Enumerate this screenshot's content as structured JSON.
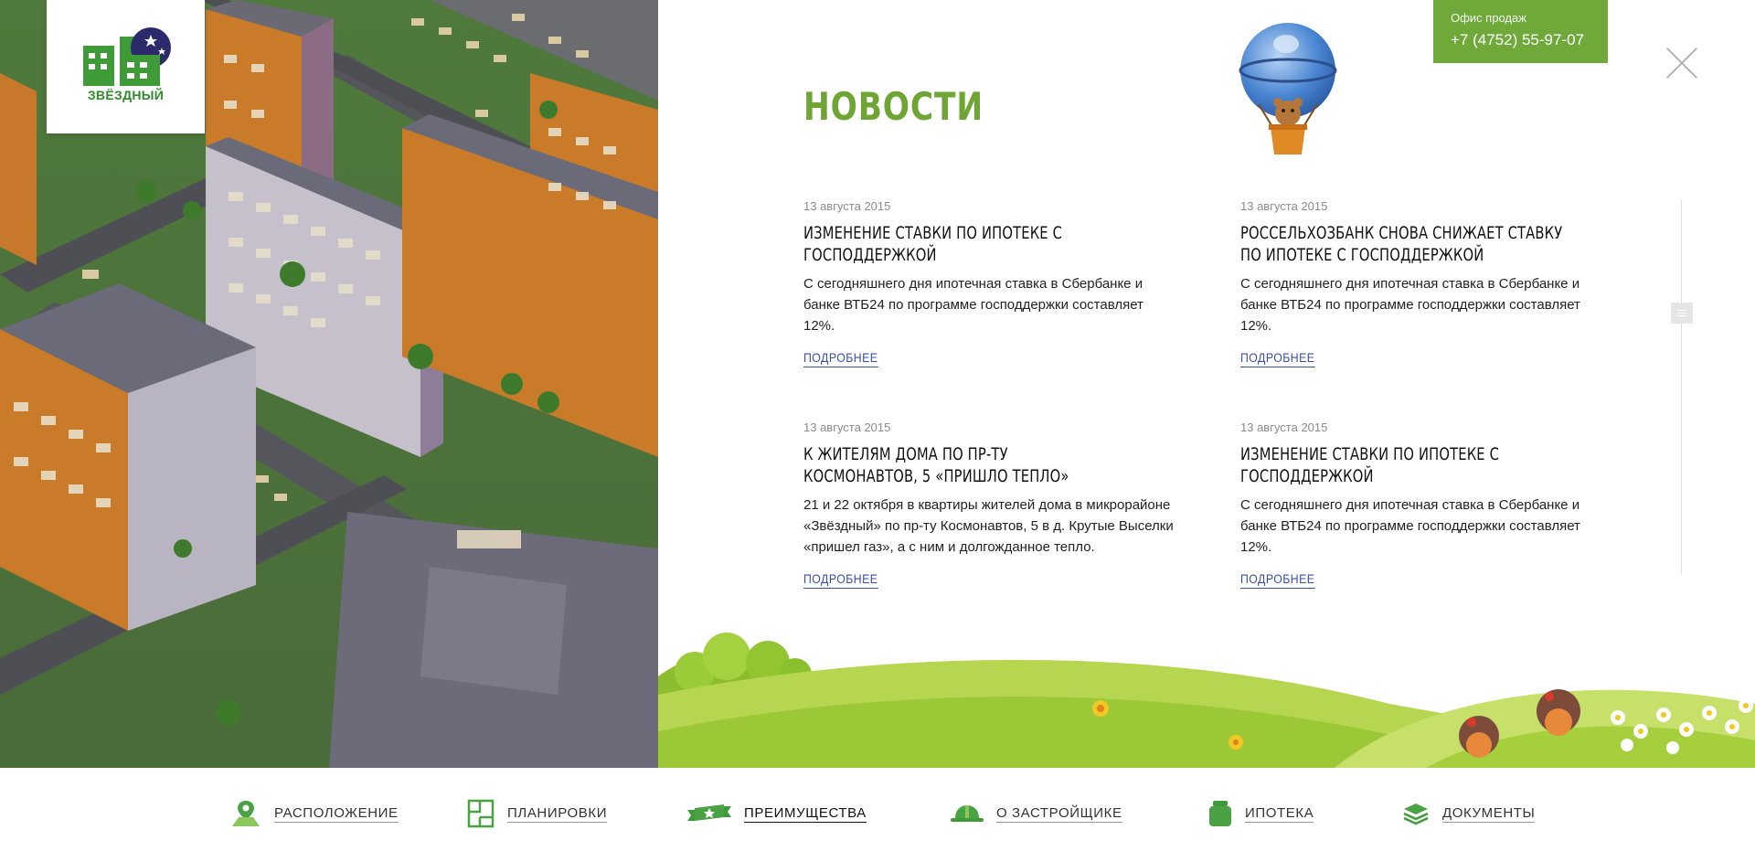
{
  "brand": {
    "logo_text": "ЗВЁЗДНЫЙ"
  },
  "office": {
    "label": "Офис продаж",
    "phone": "+7 (4752) 55-97-07"
  },
  "page_title": "НОВОСТИ",
  "news": [
    {
      "date": "13 августа 2015",
      "title": "Изменение ставки по ипотеке с господдержкой",
      "text": "С сегодняшнего дня ипотечная ставка в Сбербанке и банке ВТБ24 по программе господдержки составляет 12%.",
      "more": "Подробнее"
    },
    {
      "date": "13 августа 2015",
      "title": "Россельхозбанк снова снижает ставку по ипотеке с господдержкой",
      "text": "С сегодняшнего дня ипотечная ставка в Сбербанке и банке ВТБ24 по программе господдержки составляет 12%.",
      "more": "Подробнее"
    },
    {
      "date": "13 августа 2015",
      "title": "К жителям дома по пр-ту Космонавтов, 5 «пришло тепло»",
      "text": "21 и 22 октября в квартиры жителей дома в микрорайоне «Звёздный» по пр-ту Космонавтов, 5 в д. Крутые Выселки «пришел газ», а с ним и долгожданное тепло.",
      "more": "Подробнее"
    },
    {
      "date": "13 августа 2015",
      "title": "Изменение ставки по ипотеке с господдержкой",
      "text": "С сегодняшнего дня ипотечная ставка в Сбербанке и банке ВТБ24 по программе господдержки составляет 12%.",
      "more": "Подробнее"
    }
  ],
  "nav": [
    {
      "label": "Расположение",
      "icon": "map-pin-icon"
    },
    {
      "label": "Планировки",
      "icon": "floor-plan-icon"
    },
    {
      "label": "Преимущества",
      "icon": "ribbon-star-icon",
      "active": true
    },
    {
      "label": "О застройщике",
      "icon": "hard-hat-icon"
    },
    {
      "label": "Ипотека",
      "icon": "wallet-icon"
    },
    {
      "label": "Документы",
      "icon": "documents-stack-icon"
    }
  ],
  "colors": {
    "accent_green": "#6ea93a",
    "link_blue": "#3b4fa2",
    "title_green": "#6fa534"
  }
}
